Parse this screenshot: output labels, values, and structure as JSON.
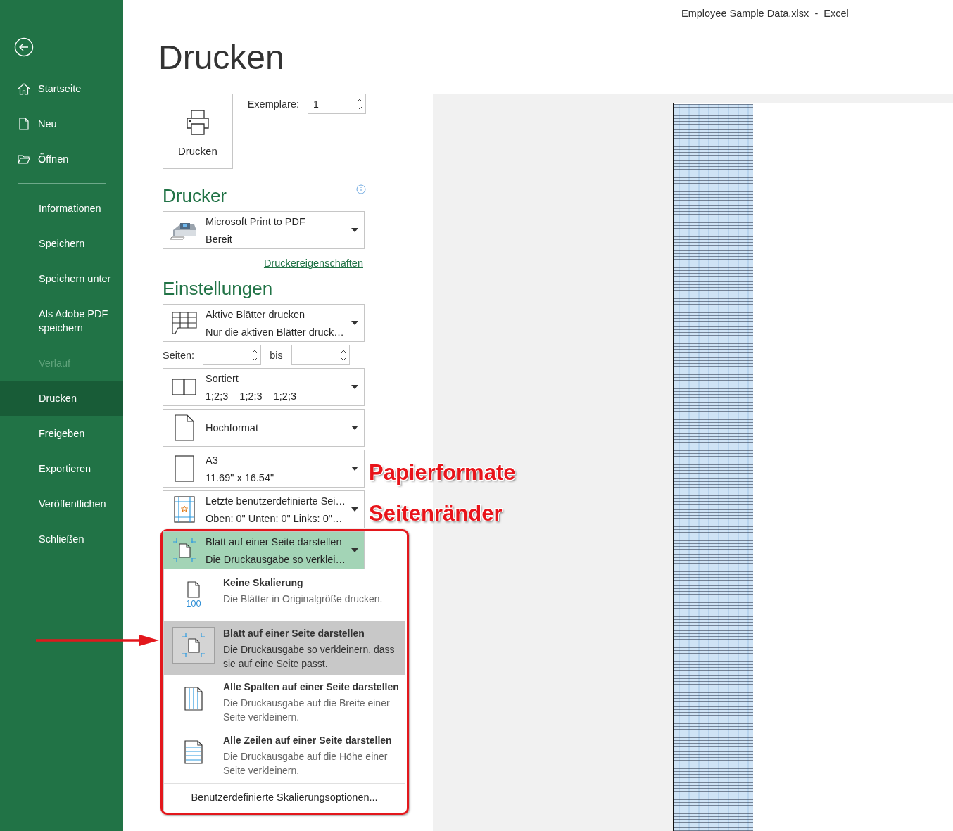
{
  "window": {
    "title": "Employee Sample Data.xlsx  -  Excel"
  },
  "sidebar": {
    "items": [
      {
        "label": "Startseite",
        "kind": "home",
        "selected": false,
        "disabled": false
      },
      {
        "label": "Neu",
        "kind": "new",
        "selected": false,
        "disabled": false
      },
      {
        "label": "Öffnen",
        "kind": "open",
        "selected": false,
        "disabled": false
      },
      {
        "label": "Informationen",
        "kind": "text",
        "selected": false,
        "disabled": false
      },
      {
        "label": "Speichern",
        "kind": "text",
        "selected": false,
        "disabled": false
      },
      {
        "label": "Speichern unter",
        "kind": "text",
        "selected": false,
        "disabled": false
      },
      {
        "label": "Als Adobe PDF speichern",
        "kind": "text",
        "selected": false,
        "disabled": false
      },
      {
        "label": "Verlauf",
        "kind": "text",
        "selected": false,
        "disabled": true
      },
      {
        "label": "Drucken",
        "kind": "text",
        "selected": true,
        "disabled": false
      },
      {
        "label": "Freigeben",
        "kind": "text",
        "selected": false,
        "disabled": false
      },
      {
        "label": "Exportieren",
        "kind": "text",
        "selected": false,
        "disabled": false
      },
      {
        "label": "Veröffentlichen",
        "kind": "text",
        "selected": false,
        "disabled": false
      },
      {
        "label": "Schließen",
        "kind": "text",
        "selected": false,
        "disabled": false
      }
    ]
  },
  "page_title": "Drucken",
  "print_button": {
    "label": "Drucken"
  },
  "copies": {
    "label": "Exemplare:",
    "value": "1"
  },
  "printer": {
    "heading": "Drucker",
    "name": "Microsoft Print to PDF",
    "status": "Bereit",
    "properties_link": "Druckereigenschaften"
  },
  "settings_heading": "Einstellungen",
  "settings": [
    {
      "kind": "sheets",
      "line1": "Aktive Blätter drucken",
      "line2": "Nur die aktiven Blätter druck…",
      "open": false
    },
    {
      "kind": "pages",
      "label": "Seiten:",
      "to_label": "bis"
    },
    {
      "kind": "collate",
      "line1": "Sortiert",
      "line2": "1;2;3    1;2;3    1;2;3",
      "open": false
    },
    {
      "kind": "portrait",
      "line1": "Hochformat",
      "open": false
    },
    {
      "kind": "paper",
      "line1": "A3",
      "line2": "11.69\" x 16.54\"",
      "open": false,
      "annotation": "Papierformate"
    },
    {
      "kind": "margins",
      "line1": "Letzte benutzerdefinierte Sei…",
      "line2": "Oben: 0\" Unten: 0\" Links: 0\"…",
      "open": false,
      "annotation": "Seitenränder"
    },
    {
      "kind": "fit",
      "line1": "Blatt auf einer Seite darstellen",
      "line2": "Die Druckausgabe so verklei…",
      "open": true
    }
  ],
  "scaling_menu": {
    "items": [
      {
        "kind": "none",
        "title": "Keine Skalierung",
        "description": "Die Blätter in Originalgröße drucken.",
        "icon_text": "100",
        "selected": false
      },
      {
        "kind": "fit-sheet",
        "title": "Blatt auf einer Seite darstellen",
        "description": "Die Druckausgabe so verkleinern, dass sie auf eine Seite passt.",
        "selected": true
      },
      {
        "kind": "fit-columns",
        "title": "Alle Spalten auf einer Seite darstellen",
        "description": "Die Druckausgabe auf die Breite einer Seite verkleinern.",
        "selected": false
      },
      {
        "kind": "fit-rows",
        "title": "Alle Zeilen auf einer Seite darstellen",
        "description": "Die Druckausgabe auf die Höhe einer Seite verkleinern.",
        "selected": false
      }
    ],
    "custom_option": "Benutzerdefinierte Skalierungsoptionen..."
  }
}
